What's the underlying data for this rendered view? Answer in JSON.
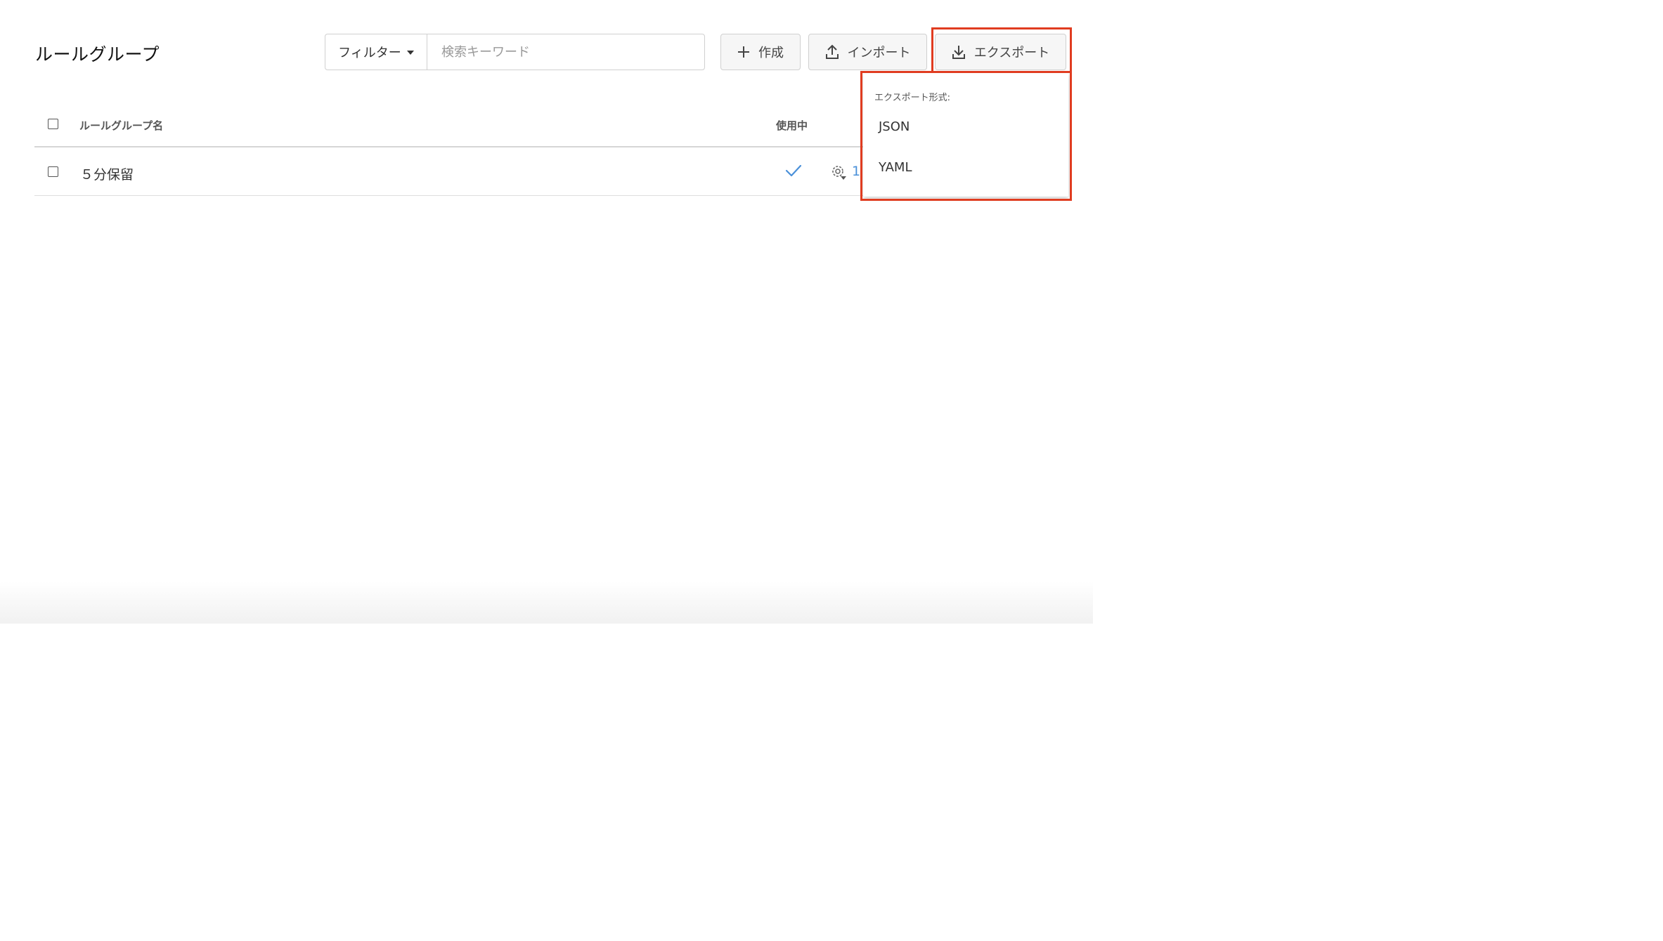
{
  "header": {
    "title": "ルールグループ"
  },
  "search": {
    "filter_label": "フィルター",
    "placeholder": "検索キーワード",
    "value": ""
  },
  "toolbar": {
    "create_label": "作成",
    "import_label": "インポート",
    "export_label": "エクスポート"
  },
  "table": {
    "columns": {
      "name": "ルールグループ名",
      "in_use": "使用中"
    },
    "rows": [
      {
        "name": "５分保留",
        "in_use": true,
        "count": "1"
      }
    ]
  },
  "export_menu": {
    "heading": "エクスポート形式:",
    "options": [
      "JSON",
      "YAML"
    ]
  },
  "colors": {
    "highlight": "#e03c20",
    "accent": "#4a90d9"
  },
  "icons": {
    "create": "plus-icon",
    "import": "upload-icon",
    "export": "download-icon",
    "filter_caret": "caret-down-icon",
    "in_use": "checkmark-icon",
    "settings": "gear-icon"
  }
}
